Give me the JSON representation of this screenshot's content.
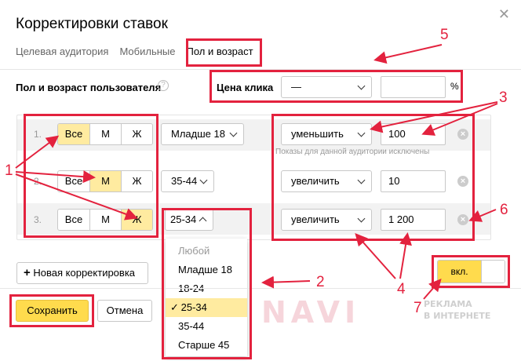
{
  "dialog": {
    "title": "Корректировки ставок",
    "close_symbol": "✕",
    "tabs": [
      "Целевая аудитория",
      "Мобильные",
      "Пол и возраст"
    ],
    "active_tab": "Пол и возраст"
  },
  "section": {
    "label": "Пол и возраст пользователя",
    "help_symbol": "?",
    "price_label": "Цена клика",
    "price_select": "—",
    "price_input": "",
    "percent_symbol": "%"
  },
  "rows": [
    {
      "num": "1.",
      "gender_options": [
        "Все",
        "М",
        "Ж"
      ],
      "gender_selected": "Все",
      "age": "Младше 18",
      "action": "уменьшить",
      "value": "100",
      "hint": "Показы для данной аудитории исключены"
    },
    {
      "num": "2.",
      "gender_options": [
        "Все",
        "М",
        "Ж"
      ],
      "gender_selected": "М",
      "age": "35-44",
      "action": "увеличить",
      "value": "10"
    },
    {
      "num": "3.",
      "gender_options": [
        "Все",
        "М",
        "Ж"
      ],
      "gender_selected": "Ж",
      "age": "25-34",
      "action": "увеличить",
      "value": "1 200"
    }
  ],
  "age_dropdown": {
    "items": [
      "Любой",
      "Младше 18",
      "18-24",
      "25-34",
      "35-44",
      "Старше 45"
    ],
    "selected": "25-34",
    "check": "✓"
  },
  "buttons": {
    "add_adjustment": "Новая корректировка",
    "add_symbol": "+",
    "save": "Сохранить",
    "cancel": "Отмена"
  },
  "toggle": {
    "label": "вкл.",
    "state": "on"
  },
  "annotations": [
    "1",
    "2",
    "3",
    "4",
    "5",
    "6",
    "7"
  ],
  "watermark": {
    "big": "NAVI",
    "small_line1": "РЕКЛАМА",
    "small_line2": "В ИНТЕРНЕТЕ"
  },
  "colors": {
    "accent_yellow": "#ffdb4d",
    "selected_yellow": "#ffeba0",
    "annotation_red": "#e3223e"
  }
}
